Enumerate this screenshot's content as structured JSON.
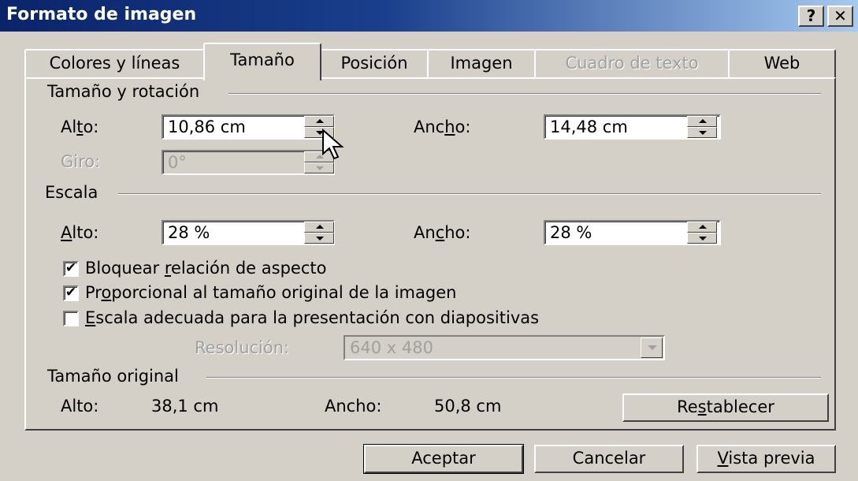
{
  "window": {
    "title": "Formato de imagen",
    "help_button": "?",
    "close_button": "✕"
  },
  "tabs": [
    {
      "label": "Colores y líneas"
    },
    {
      "label": "Tamaño"
    },
    {
      "label": "Posición"
    },
    {
      "label": "Imagen"
    },
    {
      "label": "Cuadro de texto"
    },
    {
      "label": "Web"
    }
  ],
  "size_rotation": {
    "group_label": "Tamaño y rotación",
    "height_label_pre": "Al",
    "height_label_key": "t",
    "height_label_post": "o:",
    "height_value": "10,86 cm",
    "width_label_pre": "Anc",
    "width_label_key": "h",
    "width_label_post": "o:",
    "width_value": "14,48 cm",
    "rotation_label": "Giro:",
    "rotation_value": "0°"
  },
  "scale": {
    "group_label": "Escala",
    "height_label_key": "A",
    "height_label_post": "lto:",
    "height_value": "28 %",
    "width_label_pre": "An",
    "width_label_key": "c",
    "width_label_post": "ho:",
    "width_value": "28 %",
    "lock_aspect": {
      "pre": "Bloquear ",
      "key": "r",
      "post": "elación de aspecto",
      "checked": true
    },
    "relative_original": {
      "pre": "Pr",
      "key": "o",
      "post": "porcional al tamaño original de la imagen",
      "checked": true
    },
    "best_scale": {
      "pre": "",
      "key": "E",
      "post": "scala adecuada para la presentación con diapositivas",
      "checked": false
    },
    "resolution_label": "Resolución:",
    "resolution_value": "640 x 480"
  },
  "original_size": {
    "group_label": "Tamaño original",
    "height_label": "Alto:",
    "height_value": "38,1 cm",
    "width_label": "Ancho:",
    "width_value": "50,8 cm",
    "reset_pre": "Re",
    "reset_key": "s",
    "reset_post": "tablecer"
  },
  "footer": {
    "ok": "Aceptar",
    "cancel": "Cancelar",
    "preview_key": "V",
    "preview_post": "ista previa"
  },
  "check_mark": "✔"
}
